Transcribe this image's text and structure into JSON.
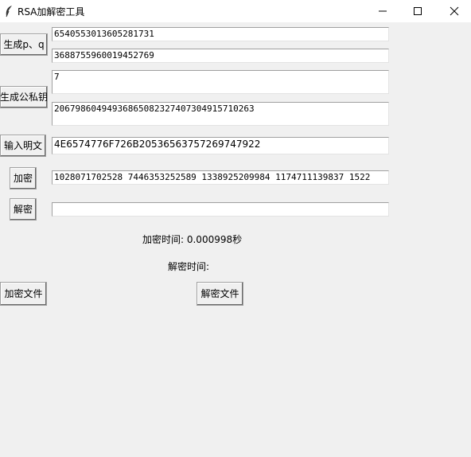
{
  "window": {
    "title": "RSA加解密工具"
  },
  "buttons": {
    "gen_pq": "生成p、q",
    "gen_keys": "生成公私钥",
    "input_plain": "输入明文",
    "encrypt": "加密",
    "decrypt": "解密",
    "encrypt_file": "加密文件",
    "decrypt_file": "解密文件"
  },
  "fields": {
    "p": "6540553013605281731",
    "q": "3688755960019452769",
    "e": "7",
    "d": "20679860494936865082327407304915710263",
    "plaintext": "4E6574776F726B20536563757269747922",
    "ciphertext": "1028071702528 7446353252589 1338925209984 1174711139837 1522",
    "decrypted": ""
  },
  "labels": {
    "encrypt_time": "加密时间: 0.000998秒",
    "decrypt_time": "解密时间:"
  },
  "icons": {
    "app": "feather-icon",
    "minimize": "minimize-icon",
    "maximize": "maximize-icon",
    "close": "close-icon"
  }
}
